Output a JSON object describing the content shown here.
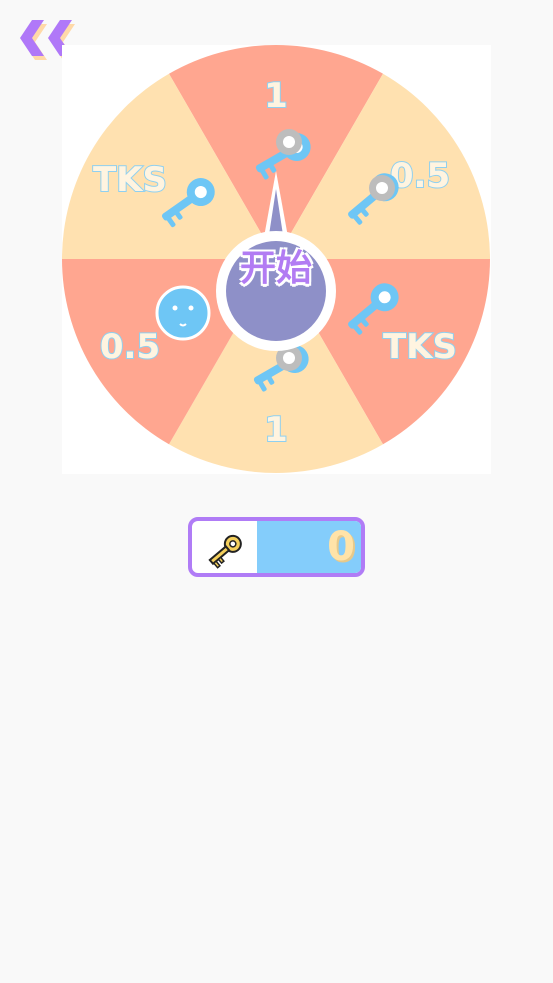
{
  "header": {
    "back_icon": "double-chevron-left-icon"
  },
  "wheel": {
    "colors": {
      "coral": "#ffa690",
      "peach": "#ffe1b0",
      "hub_purple": "#8e90c8",
      "key_blue": "#6ec6f5",
      "key_gray": "#bdbdbd",
      "text_purple": "#b27cf3"
    },
    "segments": [
      {
        "label": "1",
        "icon": "key-icon"
      },
      {
        "label": "0.5",
        "icon": "key-icon"
      },
      {
        "label": "TKS",
        "icon": "key-icon"
      },
      {
        "label": "1",
        "icon": "key-icon"
      },
      {
        "label": "0.5",
        "icon": "smiley-face-icon"
      },
      {
        "label": "TKS",
        "icon": "key-icon"
      }
    ],
    "start_label": "开始"
  },
  "key_counter": {
    "icon": "key-icon",
    "value": "0"
  }
}
